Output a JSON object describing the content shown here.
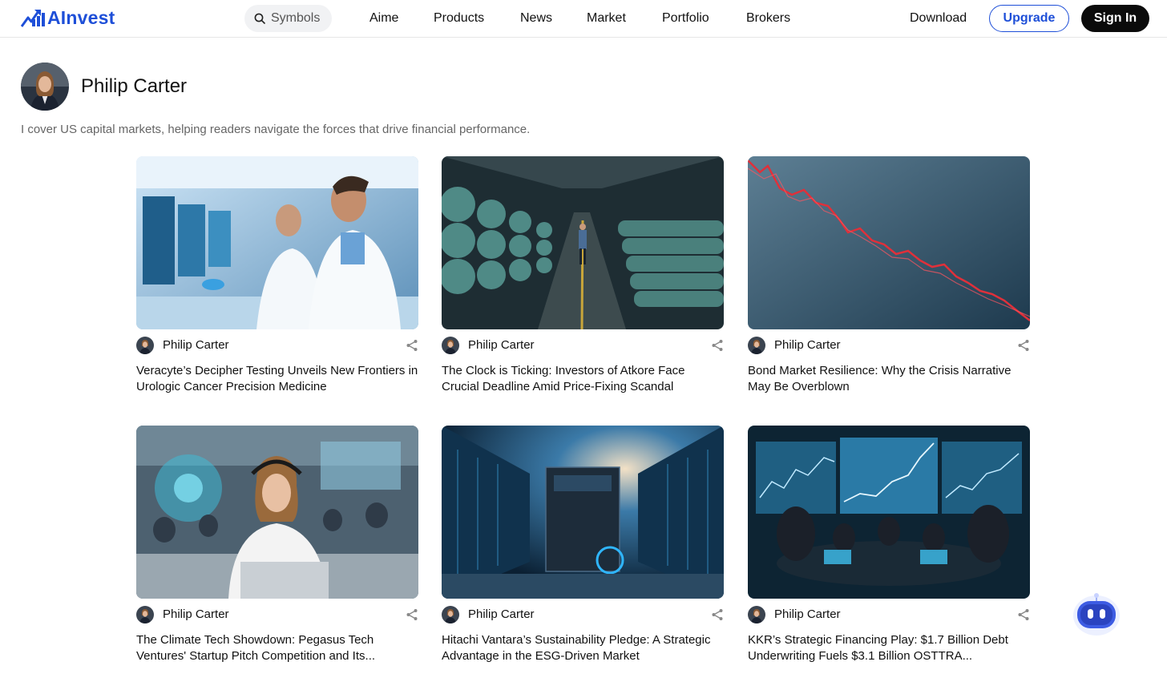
{
  "header": {
    "logo_text": "AInvest",
    "search_placeholder": "Symbols",
    "nav": [
      "Aime",
      "Products",
      "News",
      "Market",
      "Portfolio",
      "Brokers"
    ],
    "download_label": "Download",
    "upgrade_label": "Upgrade",
    "signin_label": "Sign In"
  },
  "profile": {
    "name": "Philip Carter",
    "bio": "I cover US capital markets, helping readers navigate the forces that drive financial performance."
  },
  "colors": {
    "brand": "#1e4fd8",
    "signin_bg": "#0b0b0b"
  },
  "articles": [
    {
      "author": "Philip Carter",
      "title": "Veracyte’s Decipher Testing Unveils New Frontiers in Urologic Cancer Precision Medicine",
      "image": "lab-scientists-image"
    },
    {
      "author": "Philip Carter",
      "title": "The Clock is Ticking: Investors of Atkore Face Crucial Deadline Amid Price-Fixing Scandal",
      "image": "pipe-warehouse-image"
    },
    {
      "author": "Philip Carter",
      "title": "Bond Market Resilience: Why the Crisis Narrative May Be Overblown",
      "image": "falling-chart-image"
    },
    {
      "author": "Philip Carter",
      "title": "The Climate Tech Showdown: Pegasus Tech Ventures' Startup Pitch Competition and Its...",
      "image": "pitch-competition-image"
    },
    {
      "author": "Philip Carter",
      "title": "Hitachi Vantara’s Sustainability Pledge: A Strategic Advantage in the ESG-Driven Market",
      "image": "data-center-image"
    },
    {
      "author": "Philip Carter",
      "title": "KKR’s Strategic Financing Play: $1.7 Billion Debt Underwriting Fuels $3.1 Billion OSTTRA...",
      "image": "boardroom-image"
    }
  ]
}
